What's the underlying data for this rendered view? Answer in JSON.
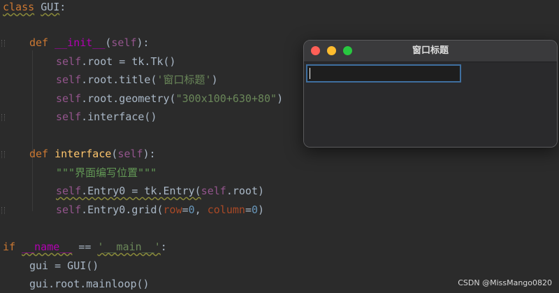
{
  "code": {
    "l1": {
      "kw": "class",
      "name": "GUI",
      "colon": ":"
    },
    "l2": {
      "kw": "def",
      "fn": "__init__",
      "open": "(",
      "self": "self",
      "close": "):"
    },
    "l3": {
      "self": "self",
      "rest": ".root = tk.Tk()"
    },
    "l4": {
      "self": "self",
      "a": ".root.title(",
      "str": "'窗口标题'",
      "b": ")"
    },
    "l5": {
      "self": "self",
      "a": ".root.geometry(",
      "str": "\"300x100+630+80\"",
      "b": ")"
    },
    "l6": {
      "self": "self",
      "rest": ".interface()"
    },
    "l7": {
      "kw": "def",
      "fn": "interface",
      "open": "(",
      "self": "self",
      "close": "):"
    },
    "l8": {
      "doc": "\"\"\"界面编写位置\"\"\""
    },
    "l9": {
      "self": "self",
      "a": ".Entry0 = tk.Entry(",
      "self2": "self",
      "b": ".root)"
    },
    "l10": {
      "self": "self",
      "a": ".Entry0.grid(",
      "p1": "row",
      "eq1": "=",
      "n1": "0",
      "comma": ", ",
      "p2": "column",
      "eq2": "=",
      "n2": "0",
      "b": ")"
    },
    "l11": {
      "kw": "if",
      "magic": "__name__",
      "op": " == ",
      "str": "'__main__'",
      "colon": ":"
    },
    "l12": {
      "rest": "gui = GUI()"
    },
    "l13": {
      "rest": "gui.root.mainloop()"
    }
  },
  "window": {
    "title": "窗口标题",
    "entry_value": ""
  },
  "watermark": "CSDN @MissMango0820",
  "colors": {
    "background": "#2b2b2b",
    "keyword": "#cc7832",
    "function": "#ffc66d",
    "self": "#94558d",
    "string": "#6a8759",
    "number": "#6897bb",
    "entry_border": "#3f6f9f"
  }
}
